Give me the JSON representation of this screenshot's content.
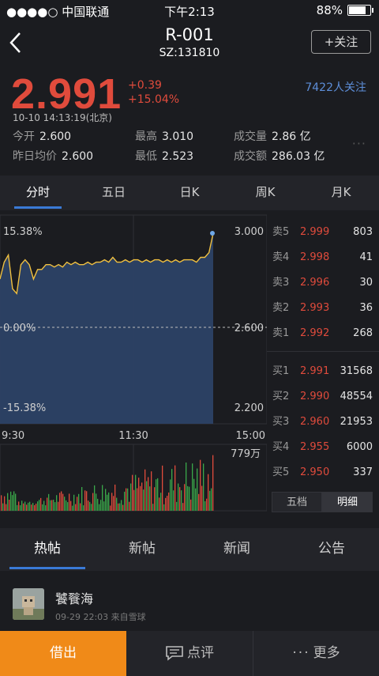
{
  "status_bar": {
    "carrier": "●●●●○ 中国联通",
    "time": "下午2:13",
    "battery": "88%",
    "battery_level": 0.88
  },
  "header": {
    "title": "R-001",
    "subtitle": "SZ:131810",
    "follow_label": "+关注"
  },
  "quote": {
    "price": "2.991",
    "change": "+0.39",
    "change_pct": "+15.04%",
    "followers": "7422人关注",
    "timestamp": "10-10 14:13:19(北京)",
    "stats": [
      {
        "label": "今开",
        "value": "2.600"
      },
      {
        "label": "最高",
        "value": "3.010"
      },
      {
        "label": "成交量",
        "value": "2.86 亿"
      },
      {
        "label": "昨日均价",
        "value": "2.600"
      },
      {
        "label": "最低",
        "value": "2.523"
      },
      {
        "label": "成交额",
        "value": "286.03 亿"
      }
    ]
  },
  "chart_tabs": [
    "分时",
    "五日",
    "日K",
    "周K",
    "月K"
  ],
  "chart_data": {
    "type": "area",
    "title": "",
    "x_ticks": [
      "9:30",
      "11:30",
      "15:00"
    ],
    "y_left_labels": [
      "15.38%",
      "0.00%",
      "-15.38%"
    ],
    "y_right_labels": [
      "3.000",
      "2.600",
      "2.200"
    ],
    "ylim": [
      2.2,
      3.0
    ],
    "baseline": 2.6,
    "volume_max_label": "779万",
    "series": [
      {
        "values": [
          2.8,
          2.87,
          2.9,
          2.76,
          2.74,
          2.86,
          2.88,
          2.86,
          2.8,
          2.84,
          2.84,
          2.86,
          2.86,
          2.85,
          2.86,
          2.85,
          2.87,
          2.86,
          2.87,
          2.86,
          2.86,
          2.87,
          2.86,
          2.87,
          2.87,
          2.88,
          2.87,
          2.89,
          2.87,
          2.87,
          2.88,
          2.87,
          2.88,
          2.88,
          2.87,
          2.88,
          2.87,
          2.88,
          2.88,
          2.87,
          2.88,
          2.87,
          2.88,
          2.87,
          2.88,
          2.88,
          2.88,
          2.87,
          2.89,
          2.89,
          2.91,
          2.99
        ]
      }
    ]
  },
  "order_book": {
    "asks": [
      {
        "label": "卖5",
        "price": "2.999",
        "volume": "803"
      },
      {
        "label": "卖4",
        "price": "2.998",
        "volume": "41"
      },
      {
        "label": "卖3",
        "price": "2.996",
        "volume": "30"
      },
      {
        "label": "卖2",
        "price": "2.993",
        "volume": "36"
      },
      {
        "label": "卖1",
        "price": "2.992",
        "volume": "268"
      }
    ],
    "bids": [
      {
        "label": "买1",
        "price": "2.991",
        "volume": "31568"
      },
      {
        "label": "买2",
        "price": "2.990",
        "volume": "48554"
      },
      {
        "label": "买3",
        "price": "2.960",
        "volume": "21953"
      },
      {
        "label": "买4",
        "price": "2.955",
        "volume": "6000"
      },
      {
        "label": "买5",
        "price": "2.950",
        "volume": "337"
      }
    ],
    "buttons": [
      "五档",
      "明细"
    ]
  },
  "news_tabs": [
    "热帖",
    "新帖",
    "新闻",
    "公告"
  ],
  "post": {
    "user": "饕餮海",
    "meta": "09-29 22:03  来自雪球"
  },
  "bottom_bar": {
    "borrow": "借出",
    "comment": "点评",
    "more": "更多"
  },
  "colors": {
    "up": "#e04b3c",
    "accent": "#3a7ad6",
    "line": "#f0c040",
    "area": "#2c4266",
    "followers": "#5d8ed8",
    "borrow": "#f08a18"
  }
}
